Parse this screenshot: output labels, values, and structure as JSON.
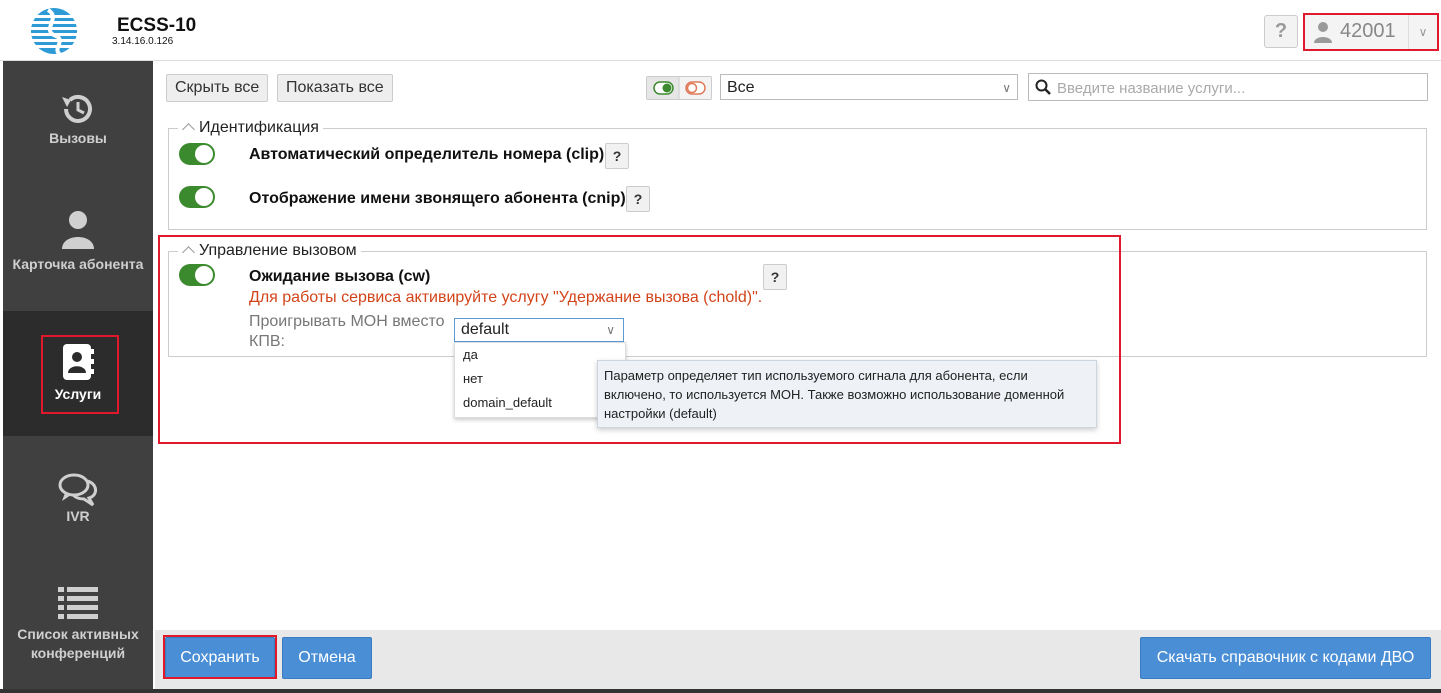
{
  "header": {
    "app_title": "ECSS-10",
    "version": "3.14.16.0.126",
    "help_label": "?",
    "user_number": "42001"
  },
  "sidebar": {
    "items": [
      {
        "label": "Вызовы",
        "icon": "history-icon"
      },
      {
        "label": "Карточка абонента",
        "icon": "person-icon"
      },
      {
        "label": "Услуги",
        "icon": "contact-book-icon",
        "active": true
      },
      {
        "label": "IVR",
        "icon": "chat-bubbles-icon"
      },
      {
        "label": "Список активных конференций",
        "icon": "list-icon"
      }
    ]
  },
  "toolbar": {
    "hide_all": "Скрыть все",
    "show_all": "Показать все",
    "filter_value": "Все",
    "search_placeholder": "Введите название услуги..."
  },
  "groups": [
    {
      "title": "Идентификация",
      "services": [
        {
          "label": "Автоматический определитель номера (clip)",
          "enabled": true
        },
        {
          "label": "Отображение имени звонящего абонента (cnip)",
          "enabled": true
        }
      ]
    },
    {
      "title": "Управление вызовом",
      "services": [
        {
          "label": "Ожидание вызова (cw)",
          "enabled": true,
          "warning": "Для работы сервиса активируйте услугу \"Удержание вызова (chold)\".",
          "param_label": "Проигрывать МОН вместо КПВ:",
          "param_value": "default",
          "param_options": [
            "да",
            "нет",
            "domain_default"
          ]
        }
      ]
    }
  ],
  "tooltip": "Параметр определяет тип используемого сигнала для абонента, если включено, то используется МОН. Также возможно использование доменной настройки (default)",
  "footer": {
    "save": "Сохранить",
    "cancel": "Отмена",
    "download": "Скачать справочник с кодами ДВО"
  },
  "colors": {
    "accent_blue": "#4a8fd6",
    "toggle_on": "#3c8a2e",
    "warning_text": "#d2441a",
    "highlight_frame": "#e0192c",
    "sidebar_bg": "#404040"
  }
}
